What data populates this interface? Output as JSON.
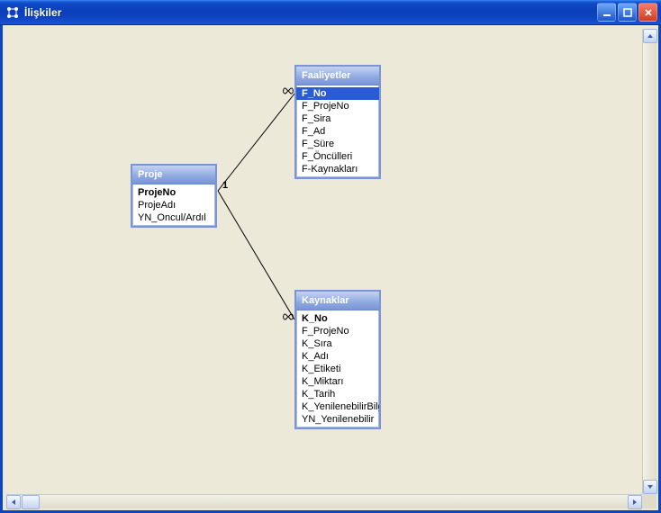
{
  "window": {
    "title": "İlişkiler"
  },
  "entities": {
    "proje": {
      "title": "Proje",
      "fields": [
        "ProjeNo",
        "ProjeAdı",
        "YN_Oncul/Ardıl"
      ]
    },
    "faaliyetler": {
      "title": "Faaliyetler",
      "fields": [
        "F_No",
        "F_ProjeNo",
        "F_Sira",
        "F_Ad",
        "F_Süre",
        "F_Öncülleri",
        "F-Kaynakları"
      ]
    },
    "kaynaklar": {
      "title": "Kaynaklar",
      "fields": [
        "K_No",
        "F_ProjeNo",
        "K_Sıra",
        "K_Adı",
        "K_Etiketi",
        "K_Miktarı",
        "K_Tarih",
        "K_YenilenebilirBilg",
        "YN_Yenilenebilir"
      ]
    }
  },
  "relations": {
    "card_one": "1"
  }
}
